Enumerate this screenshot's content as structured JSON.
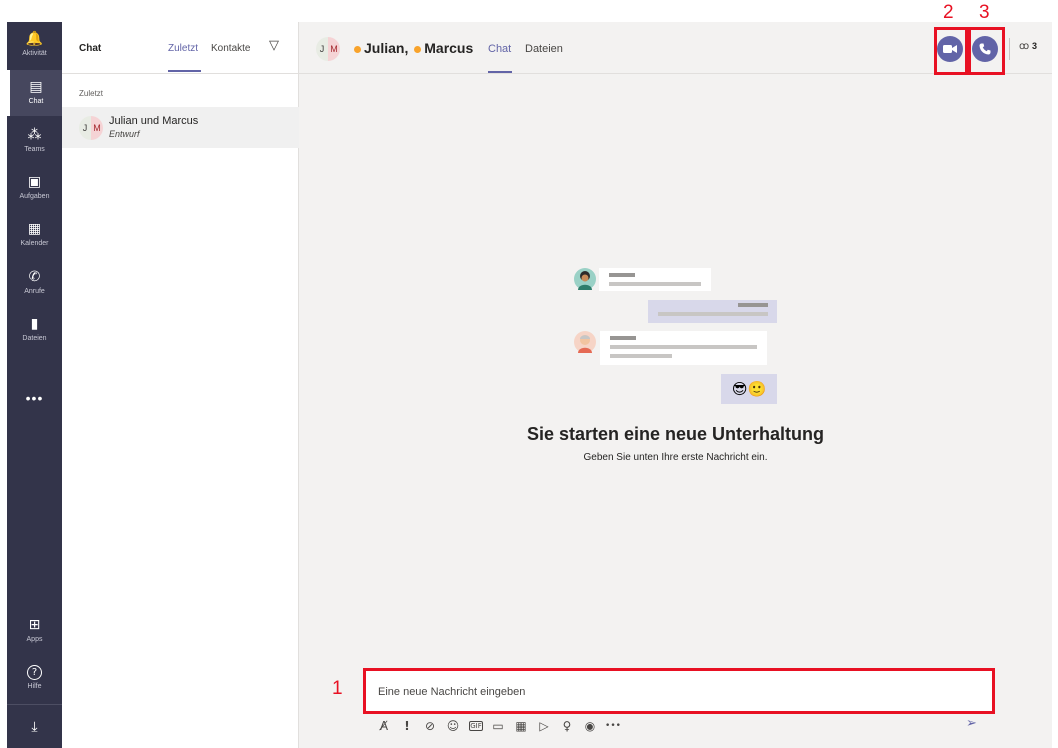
{
  "rail": {
    "items": [
      {
        "label": "Aktivität",
        "icon": "bell-icon",
        "glyph": "🔔"
      },
      {
        "label": "Chat",
        "icon": "chat-icon",
        "glyph": "▤"
      },
      {
        "label": "Teams",
        "icon": "teams-icon",
        "glyph": "⁂"
      },
      {
        "label": "Aufgaben",
        "icon": "briefcase-icon",
        "glyph": "▣"
      },
      {
        "label": "Kalender",
        "icon": "calendar-icon",
        "glyph": "▦"
      },
      {
        "label": "Anrufe",
        "icon": "phone-icon",
        "glyph": "✆"
      },
      {
        "label": "Dateien",
        "icon": "file-icon",
        "glyph": "▮"
      }
    ],
    "more": "•••",
    "apps_label": "Apps",
    "help_label": "Hilfe",
    "apps_glyph": "⊞",
    "help_glyph": "?",
    "download_glyph": "⤓"
  },
  "list": {
    "title": "Chat",
    "tab_recent": "Zuletzt",
    "tab_contacts": "Kontakte",
    "filter_glyph": "▽",
    "section": "Zuletzt",
    "entry": {
      "initial_1": "J",
      "initial_2": "M",
      "name": "Julian und Marcus",
      "draft": "Entwurf"
    }
  },
  "main": {
    "initial_1": "J",
    "initial_2": "M",
    "participant_1": "Julian,",
    "participant_2": "Marcus",
    "tab_chat": "Chat",
    "tab_files": "Dateien",
    "participants_count": "3",
    "people_glyph": "ꝏ",
    "empty_title": "Sie starten eine neue Unterhaltung",
    "empty_subtitle": "Geben Sie unten Ihre erste Nachricht ein.",
    "composer_placeholder": "Eine neue Nachricht eingeben",
    "emoji_1": "😎",
    "emoji_2": "🙂",
    "toolbar": [
      "A̸",
      "!",
      "⊘",
      "☺",
      "GIF",
      "▭",
      "▦",
      "▷",
      "♀",
      "◉",
      "•••"
    ],
    "send_glyph": "➢"
  },
  "annotations": {
    "n1": "1",
    "n2": "2",
    "n3": "3"
  },
  "colors": {
    "brand": "#6264a7",
    "rail": "#33344a",
    "annotation": "#e81123",
    "presence_away": "#f8a32b"
  }
}
